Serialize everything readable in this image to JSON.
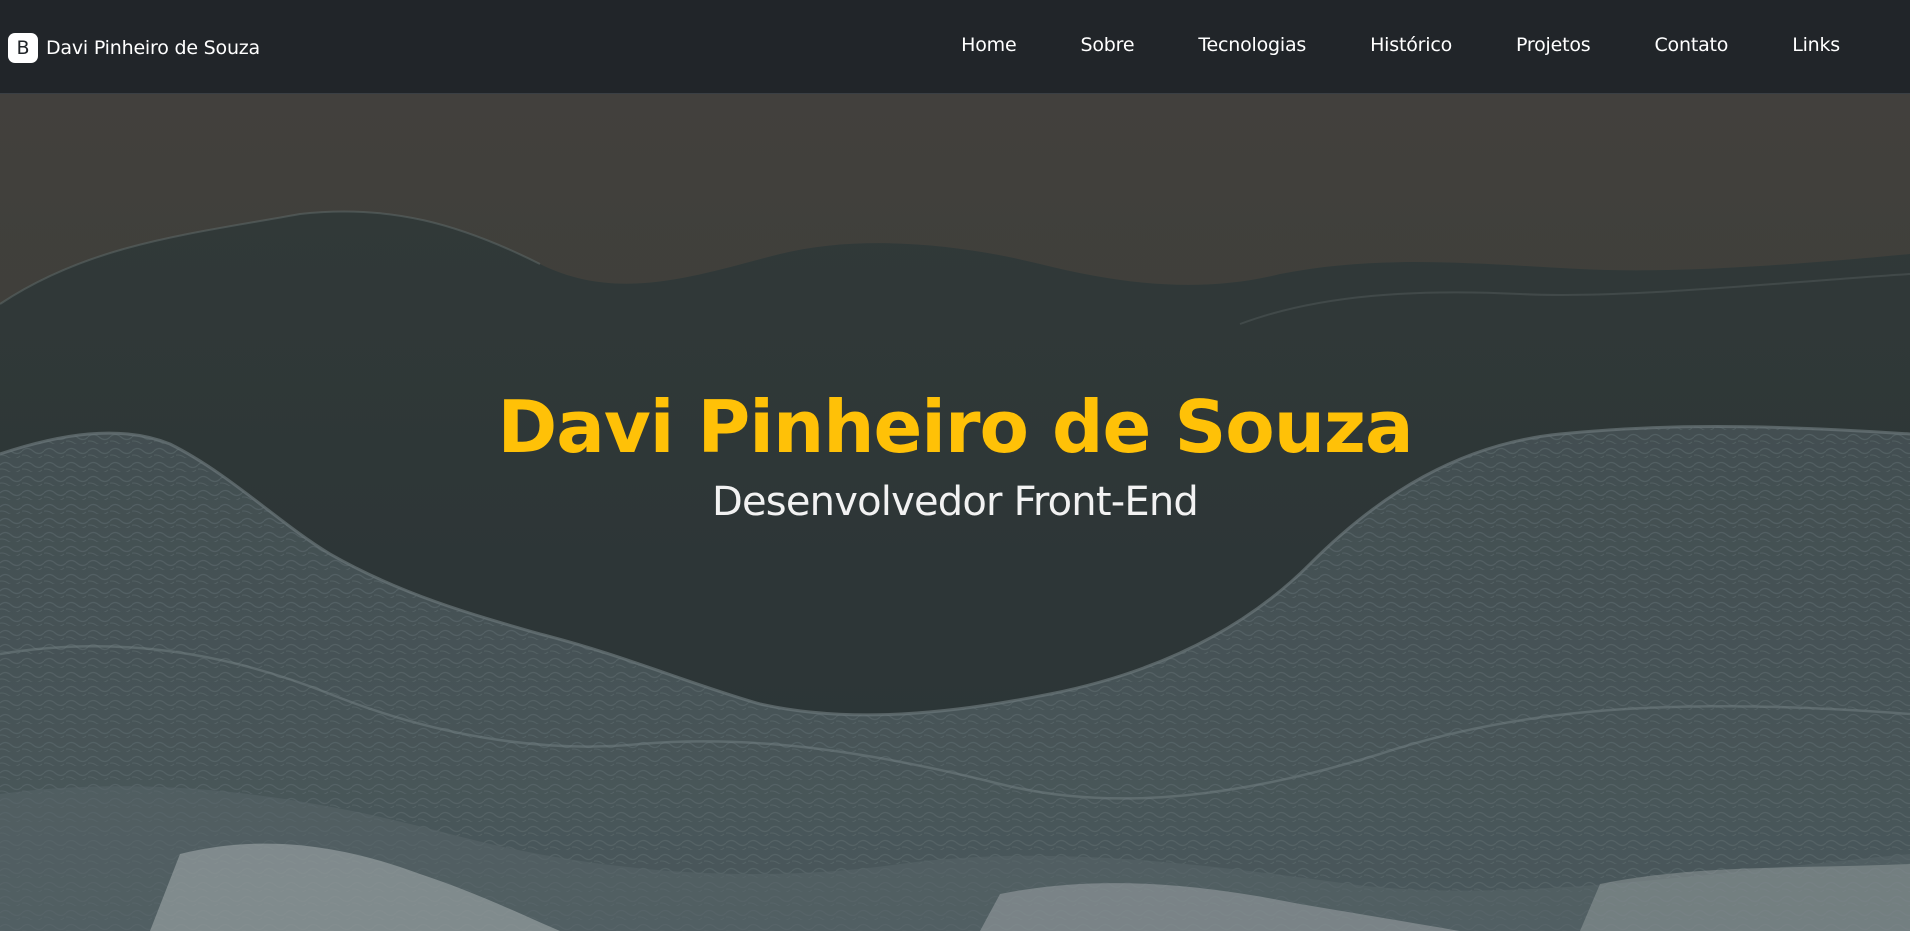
{
  "navbar": {
    "brand": {
      "logo_letter": "B",
      "name": "Davi Pinheiro de Souza"
    },
    "items": [
      {
        "label": "Home"
      },
      {
        "label": "Sobre"
      },
      {
        "label": "Tecnologias"
      },
      {
        "label": "Histórico"
      },
      {
        "label": "Projetos"
      },
      {
        "label": "Contato"
      },
      {
        "label": "Links"
      }
    ]
  },
  "hero": {
    "title": "Davi Pinheiro de Souza",
    "subtitle": "Desenvolvedor Front-End"
  },
  "colors": {
    "navbar_bg": "#212529",
    "title": "#ffc107",
    "subtitle": "#f2f2f2",
    "nav_text": "#ffffff"
  }
}
